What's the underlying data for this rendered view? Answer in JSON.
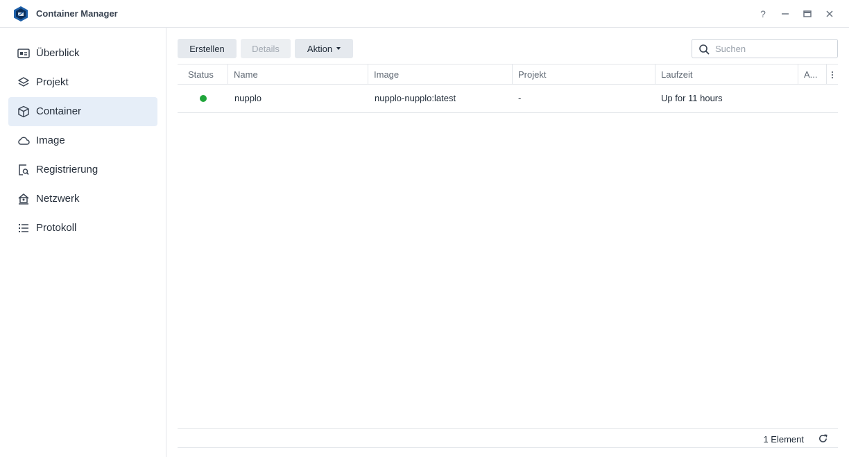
{
  "window": {
    "title": "Container Manager",
    "help_label": "?",
    "minimize_label": "—",
    "close_label": "✕"
  },
  "sidebar": {
    "items": [
      {
        "label": "Überblick",
        "icon": "overview-icon",
        "active": false
      },
      {
        "label": "Projekt",
        "icon": "project-layers-icon",
        "active": false
      },
      {
        "label": "Container",
        "icon": "container-cube-icon",
        "active": true
      },
      {
        "label": "Image",
        "icon": "cloud-icon",
        "active": false
      },
      {
        "label": "Registrierung",
        "icon": "registry-search-icon",
        "active": false
      },
      {
        "label": "Netzwerk",
        "icon": "network-icon",
        "active": false
      },
      {
        "label": "Protokoll",
        "icon": "log-list-icon",
        "active": false
      }
    ]
  },
  "toolbar": {
    "create_label": "Erstellen",
    "details_label": "Details",
    "action_label": "Aktion"
  },
  "search": {
    "placeholder": "Suchen",
    "value": ""
  },
  "table": {
    "columns": [
      "Status",
      "Name",
      "Image",
      "Projekt",
      "Laufzeit",
      "A..."
    ],
    "rows": [
      {
        "status": "running",
        "name": "nupplo",
        "image": "nupplo-nupplo:latest",
        "project": "-",
        "uptime": "Up for 11 hours"
      }
    ]
  },
  "footer": {
    "count_label": "1 Element"
  },
  "colors": {
    "accent": "#e6eef8",
    "status_running": "#1fa53a",
    "logo": "#1d5fa8"
  }
}
